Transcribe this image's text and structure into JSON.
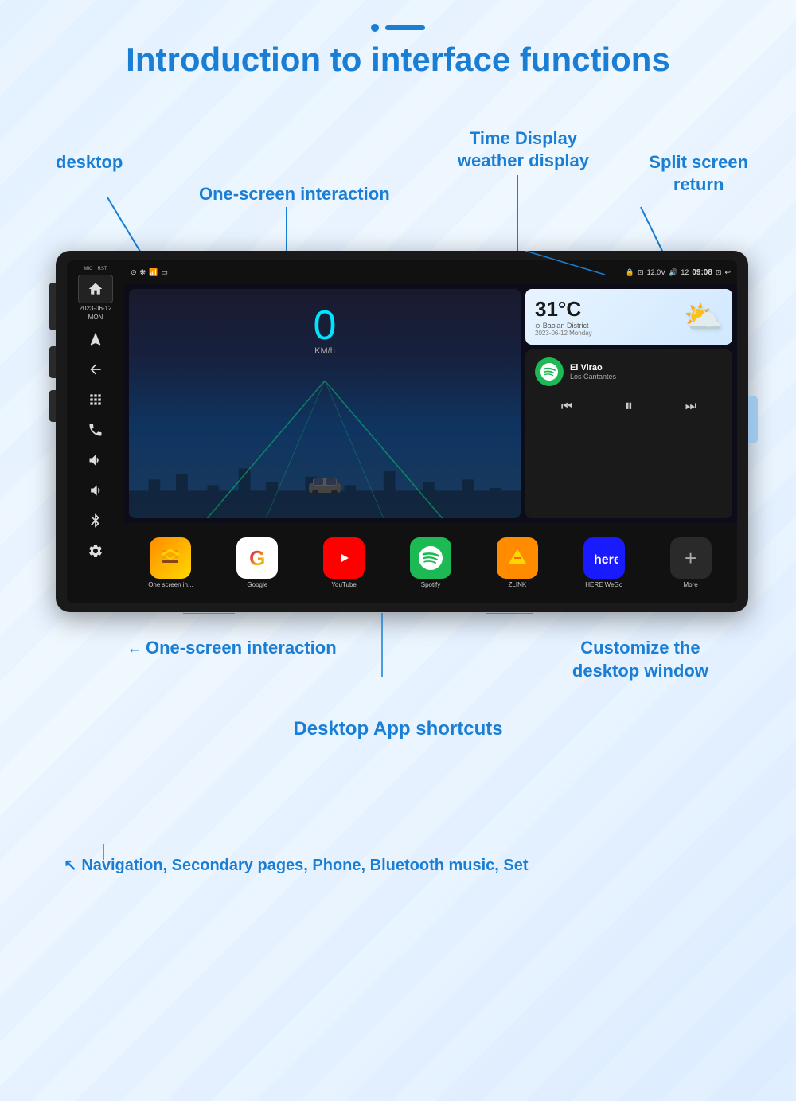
{
  "page": {
    "title": "Introduction to interface functions",
    "header_indicator": {
      "dot": "•",
      "dash": "—"
    }
  },
  "annotations": {
    "desktop": "desktop",
    "one_screen_interaction_top": "One-screen interaction",
    "time_display": "Time Display",
    "weather_display": "weather display",
    "split_screen_return": "Split screen\nreturn",
    "one_screen_interaction_bottom": "One-screen\ninteraction",
    "customize_desktop": "Customize the\ndesktop window",
    "desktop_app_shortcuts": "Desktop App shortcuts",
    "nav_secondary": "Navigation, Secondary pages, Phone, Bluetooth music, Set"
  },
  "device": {
    "status_bar": {
      "left_icons": [
        "⊙",
        "❋",
        "📶",
        "🔋"
      ],
      "voltage": "12.0V",
      "signal": "12",
      "time": "09:08"
    },
    "sidebar": {
      "mic_label": "MIC",
      "rst_label": "RST",
      "date": "2023-06-12",
      "day": "MON",
      "icons": [
        "🏠",
        "◁",
        "⊞◇",
        "☎",
        "❋",
        "⚙"
      ]
    },
    "speed": {
      "value": "0",
      "unit": "KM/h"
    },
    "weather": {
      "temp": "31°C",
      "city": "Bao'an District",
      "date": "2023-06-12 Monday",
      "icon": "⛅"
    },
    "music": {
      "player": "Spotify",
      "track": "El Virao",
      "artist": "Los Cantantes"
    },
    "apps": [
      {
        "name": "One screen in...",
        "icon": "layers",
        "color": "onescreen"
      },
      {
        "name": "Google",
        "icon": "G",
        "color": "google"
      },
      {
        "name": "YouTube",
        "icon": "▶",
        "color": "youtube"
      },
      {
        "name": "Spotify",
        "icon": "♪",
        "color": "spotify"
      },
      {
        "name": "ZLINK",
        "icon": "📱",
        "color": "zlink"
      },
      {
        "name": "HERE WeGo",
        "icon": "here",
        "color": "here"
      },
      {
        "name": "More",
        "icon": "+",
        "color": "more"
      }
    ]
  },
  "bottom": {
    "one_screen_interaction": "One-screen\ninteraction",
    "customize_desktop": "Customize the\ndesktop window",
    "desktop_shortcuts": "Desktop App shortcuts",
    "navigation_label": "↖ Navigation, Secondary pages, Phone, Bluetooth music, Set"
  }
}
